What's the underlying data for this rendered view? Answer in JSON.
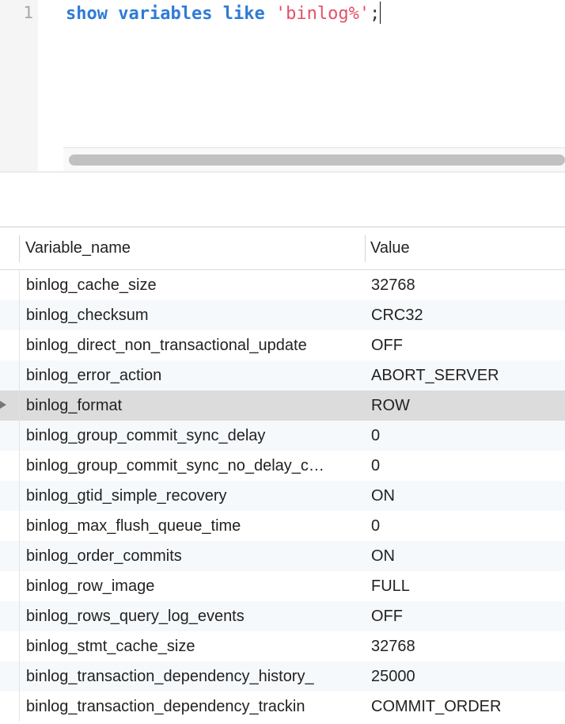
{
  "editor": {
    "line_number": "1",
    "tokens": {
      "kw_show": "show",
      "kw_variables": "variables",
      "kw_like": "like",
      "string": "'binlog%'",
      "terminator": ";"
    }
  },
  "results": {
    "columns": [
      "Variable_name",
      "Value"
    ],
    "selected_row": 4,
    "rows": [
      {
        "name": "binlog_cache_size",
        "value": "32768"
      },
      {
        "name": "binlog_checksum",
        "value": "CRC32"
      },
      {
        "name": "binlog_direct_non_transactional_update",
        "value": "OFF"
      },
      {
        "name": "binlog_error_action",
        "value": "ABORT_SERVER"
      },
      {
        "name": "binlog_format",
        "value": "ROW"
      },
      {
        "name": "binlog_group_commit_sync_delay",
        "value": "0"
      },
      {
        "name": "binlog_group_commit_sync_no_delay_c…",
        "value": "0"
      },
      {
        "name": "binlog_gtid_simple_recovery",
        "value": "ON"
      },
      {
        "name": "binlog_max_flush_queue_time",
        "value": "0"
      },
      {
        "name": "binlog_order_commits",
        "value": "ON"
      },
      {
        "name": "binlog_row_image",
        "value": "FULL"
      },
      {
        "name": "binlog_rows_query_log_events",
        "value": "OFF"
      },
      {
        "name": "binlog_stmt_cache_size",
        "value": "32768"
      },
      {
        "name": "binlog_transaction_dependency_history_",
        "value": "25000"
      },
      {
        "name": "binlog_transaction_dependency_trackin",
        "value": "COMMIT_ORDER"
      }
    ]
  },
  "colors": {
    "keyword": "#2f7bd6",
    "string": "#e35166",
    "selected_row": "#dcdcdc",
    "alt_row": "#f6f9fc"
  },
  "icons": {
    "row_marker": "current-row-arrow-icon"
  }
}
